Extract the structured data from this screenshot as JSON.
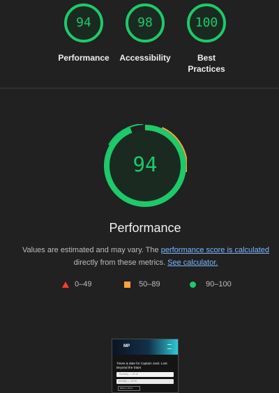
{
  "scores": [
    {
      "value": "94",
      "label_lines": [
        "Performance"
      ]
    },
    {
      "value": "98",
      "label_lines": [
        "Accessibility"
      ]
    },
    {
      "value": "100",
      "label_lines": [
        "Best",
        "Practices"
      ]
    }
  ],
  "colors": {
    "pass": "#1ec96a",
    "average": "#ffa33a",
    "fail": "#ff3b30",
    "link": "#7cb7ff",
    "background": "#212121"
  },
  "performance": {
    "score": "94",
    "title": "Performance",
    "disclaimer_prefix": "Values are estimated and may vary. The ",
    "score_link": "performance score is calculated",
    "disclaimer_middle": " directly from these metrics. ",
    "calculator_link": "See calculator."
  },
  "legend": [
    {
      "range": "0–49",
      "icon": "triangle-fail-icon"
    },
    {
      "range": "50–89",
      "icon": "square-average-icon"
    },
    {
      "range": "90–100",
      "icon": "circle-pass-icon"
    }
  ],
  "thumbnail": {
    "logo": "MP",
    "title": "Times & date for Captain Jack: Lost Beyond the Stars",
    "field1": "Thursday — 19:15",
    "field2": "Monday — 13:15",
    "button": "Back to Films"
  }
}
